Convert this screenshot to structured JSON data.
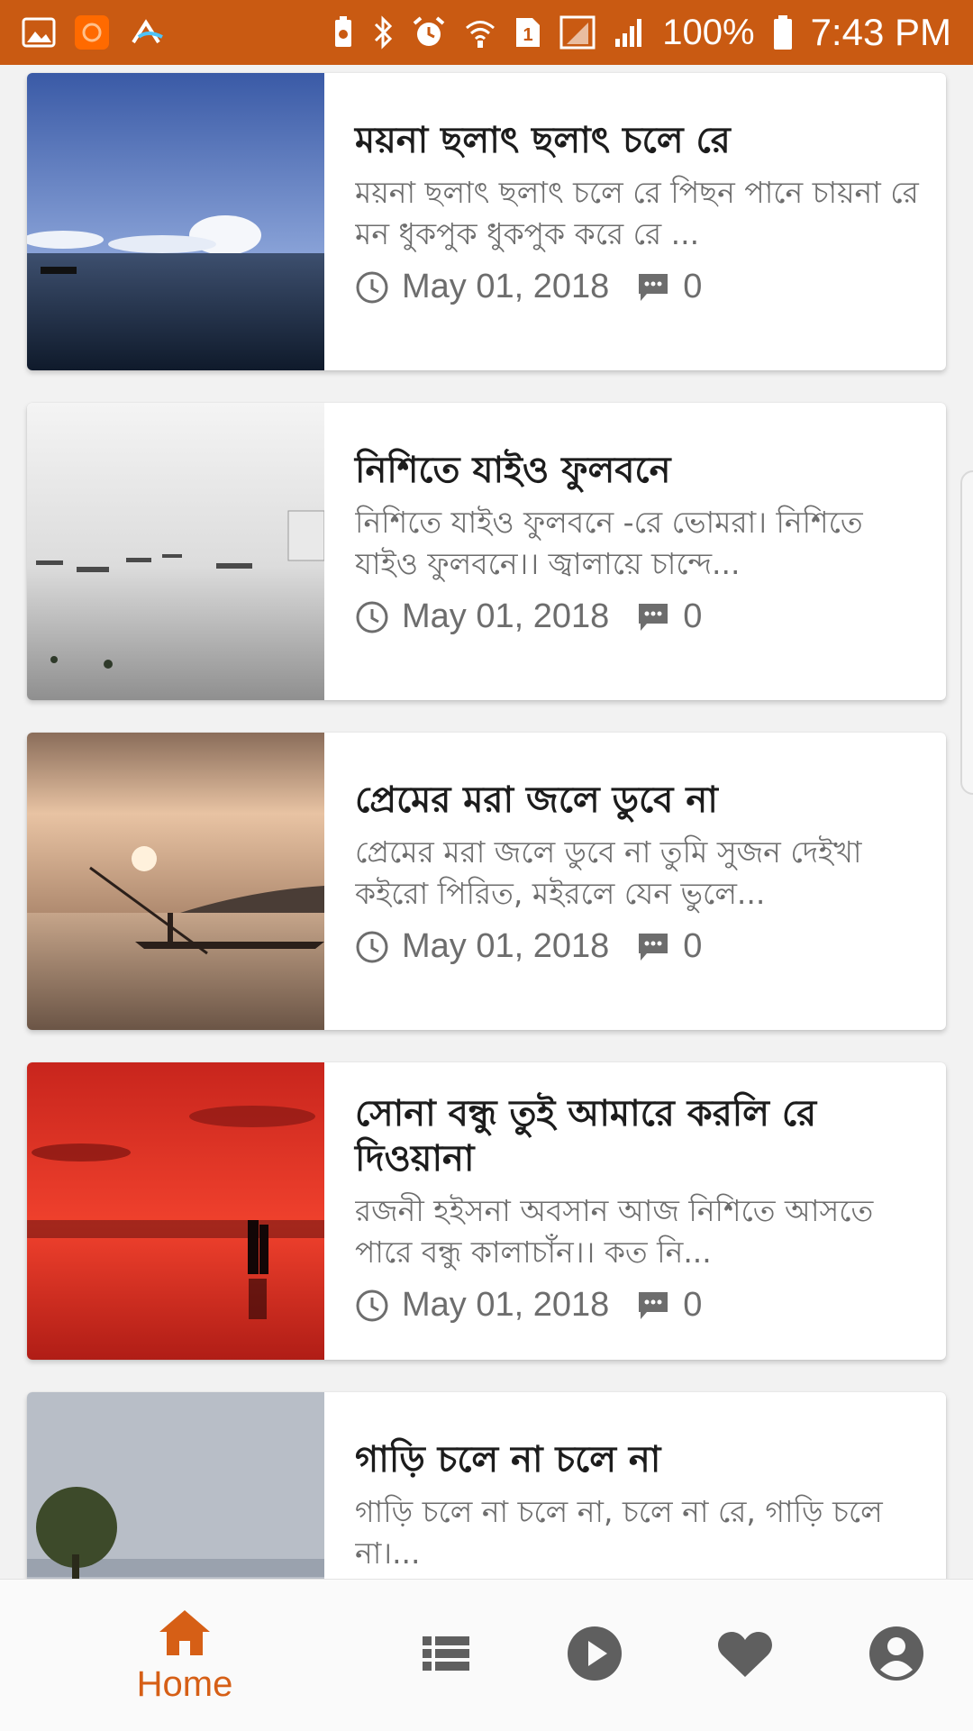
{
  "colors": {
    "status_bar": "#c95a12",
    "accent": "#d65f16",
    "nav_icon_inactive": "#5f5f5f",
    "title_text": "#1c1c1c",
    "secondary_text": "#6d6d6d"
  },
  "status_bar": {
    "left_icons": [
      "gallery-icon",
      "app-notification-icon",
      "cloud-app-icon"
    ],
    "right_icons": [
      "battery-saver-icon",
      "bluetooth-icon",
      "alarm-icon",
      "wifi-icon",
      "sim-1-icon",
      "signal-icon",
      "signal-icon-2"
    ],
    "battery": "100%",
    "time": "7:43 PM"
  },
  "posts": [
    {
      "title": "ময়না ছলাৎ ছলাৎ চলে রে",
      "excerpt": "ময়না ছলাৎ ছলাৎ চলে রে  পিছন পানে চায়না রে  মন ধুকপুক ধুকপুক করে রে  ...",
      "date": "May 01, 2018",
      "comments": "0",
      "image": "lake-under-blue-sky"
    },
    {
      "title": "নিশিতে যাইও ফুলবনে",
      "excerpt": "নিশিতে যাইও ফুলবনে  -রে ভোমরা। নিশিতে যাইও ফুলবনে।। জ্বালায়ে চান্দে...",
      "date": "May 01, 2018",
      "comments": "0",
      "image": "misty-river-boats"
    },
    {
      "title": "প্রেমের মরা জলে ডুবে না",
      "excerpt": "  প্রেমের মরা জলে ডুবে না  তুমি সুজন দেইখা কইরো পিরিত,  মইরলে যেন ভুলে...",
      "date": "May 01, 2018",
      "comments": "0",
      "image": "boatman-at-sunset"
    },
    {
      "title": "সোনা বন্ধু তুই আমারে করলি রে দিওয়ানা",
      "excerpt": "রজনী হইসনা অবসান  আজ নিশিতে আসতে পারে  বন্ধু কালাচাঁন।। কত নি...",
      "date": "May 01, 2018",
      "comments": "0",
      "image": "couple-on-red-beach"
    },
    {
      "title": "গাড়ি চলে না চলে না",
      "excerpt": "গাড়ি চলে না চলে না, চলে না রে, গাড়ি চলে না।...",
      "date": "",
      "comments": "",
      "image": "tree-by-lake"
    }
  ],
  "bottom_nav": {
    "items": [
      {
        "name": "home",
        "label": "Home",
        "icon": "home-icon",
        "active": true
      },
      {
        "name": "list",
        "label": "",
        "icon": "list-icon",
        "active": false
      },
      {
        "name": "play",
        "label": "",
        "icon": "play-circle-icon",
        "active": false
      },
      {
        "name": "favorites",
        "label": "",
        "icon": "heart-icon",
        "active": false
      },
      {
        "name": "profile",
        "label": "",
        "icon": "account-icon",
        "active": false
      }
    ]
  }
}
